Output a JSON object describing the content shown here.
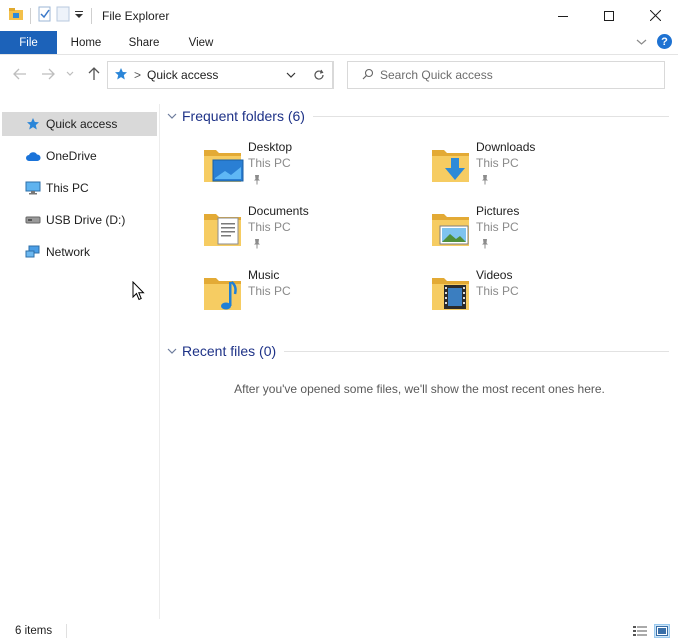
{
  "window": {
    "title": "File Explorer"
  },
  "ribbon": {
    "tabs": [
      {
        "label": "File"
      },
      {
        "label": "Home"
      },
      {
        "label": "Share"
      },
      {
        "label": "View"
      }
    ],
    "help_label": "?"
  },
  "address": {
    "separator": ">",
    "location": "Quick access"
  },
  "search": {
    "placeholder": "Search Quick access"
  },
  "navpane": {
    "items": [
      {
        "label": "Quick access",
        "icon": "star-icon",
        "selected": true
      },
      {
        "label": "OneDrive",
        "icon": "cloud-icon"
      },
      {
        "label": "This PC",
        "icon": "computer-icon"
      },
      {
        "label": "USB Drive (D:)",
        "icon": "usb-drive-icon"
      },
      {
        "label": "Network",
        "icon": "network-icon"
      }
    ]
  },
  "frequent": {
    "title": "Frequent folders (6)",
    "folders": [
      {
        "name": "Desktop",
        "location": "This PC",
        "pinned": true,
        "icon": "desktop-folder-icon"
      },
      {
        "name": "Downloads",
        "location": "This PC",
        "pinned": true,
        "icon": "downloads-folder-icon"
      },
      {
        "name": "Documents",
        "location": "This PC",
        "pinned": true,
        "icon": "documents-folder-icon"
      },
      {
        "name": "Pictures",
        "location": "This PC",
        "pinned": true,
        "icon": "pictures-folder-icon"
      },
      {
        "name": "Music",
        "location": "This PC",
        "pinned": false,
        "icon": "music-folder-icon"
      },
      {
        "name": "Videos",
        "location": "This PC",
        "pinned": false,
        "icon": "videos-folder-icon"
      }
    ]
  },
  "recent": {
    "title": "Recent files (0)",
    "empty_message": "After you've opened some files, we'll show the most recent ones here."
  },
  "status": {
    "item_count": "6 items"
  },
  "colors": {
    "accent": "#1c62b9",
    "group_title": "#1e3287",
    "selection": "#d9d9d9",
    "folder": "#f3c04a"
  }
}
